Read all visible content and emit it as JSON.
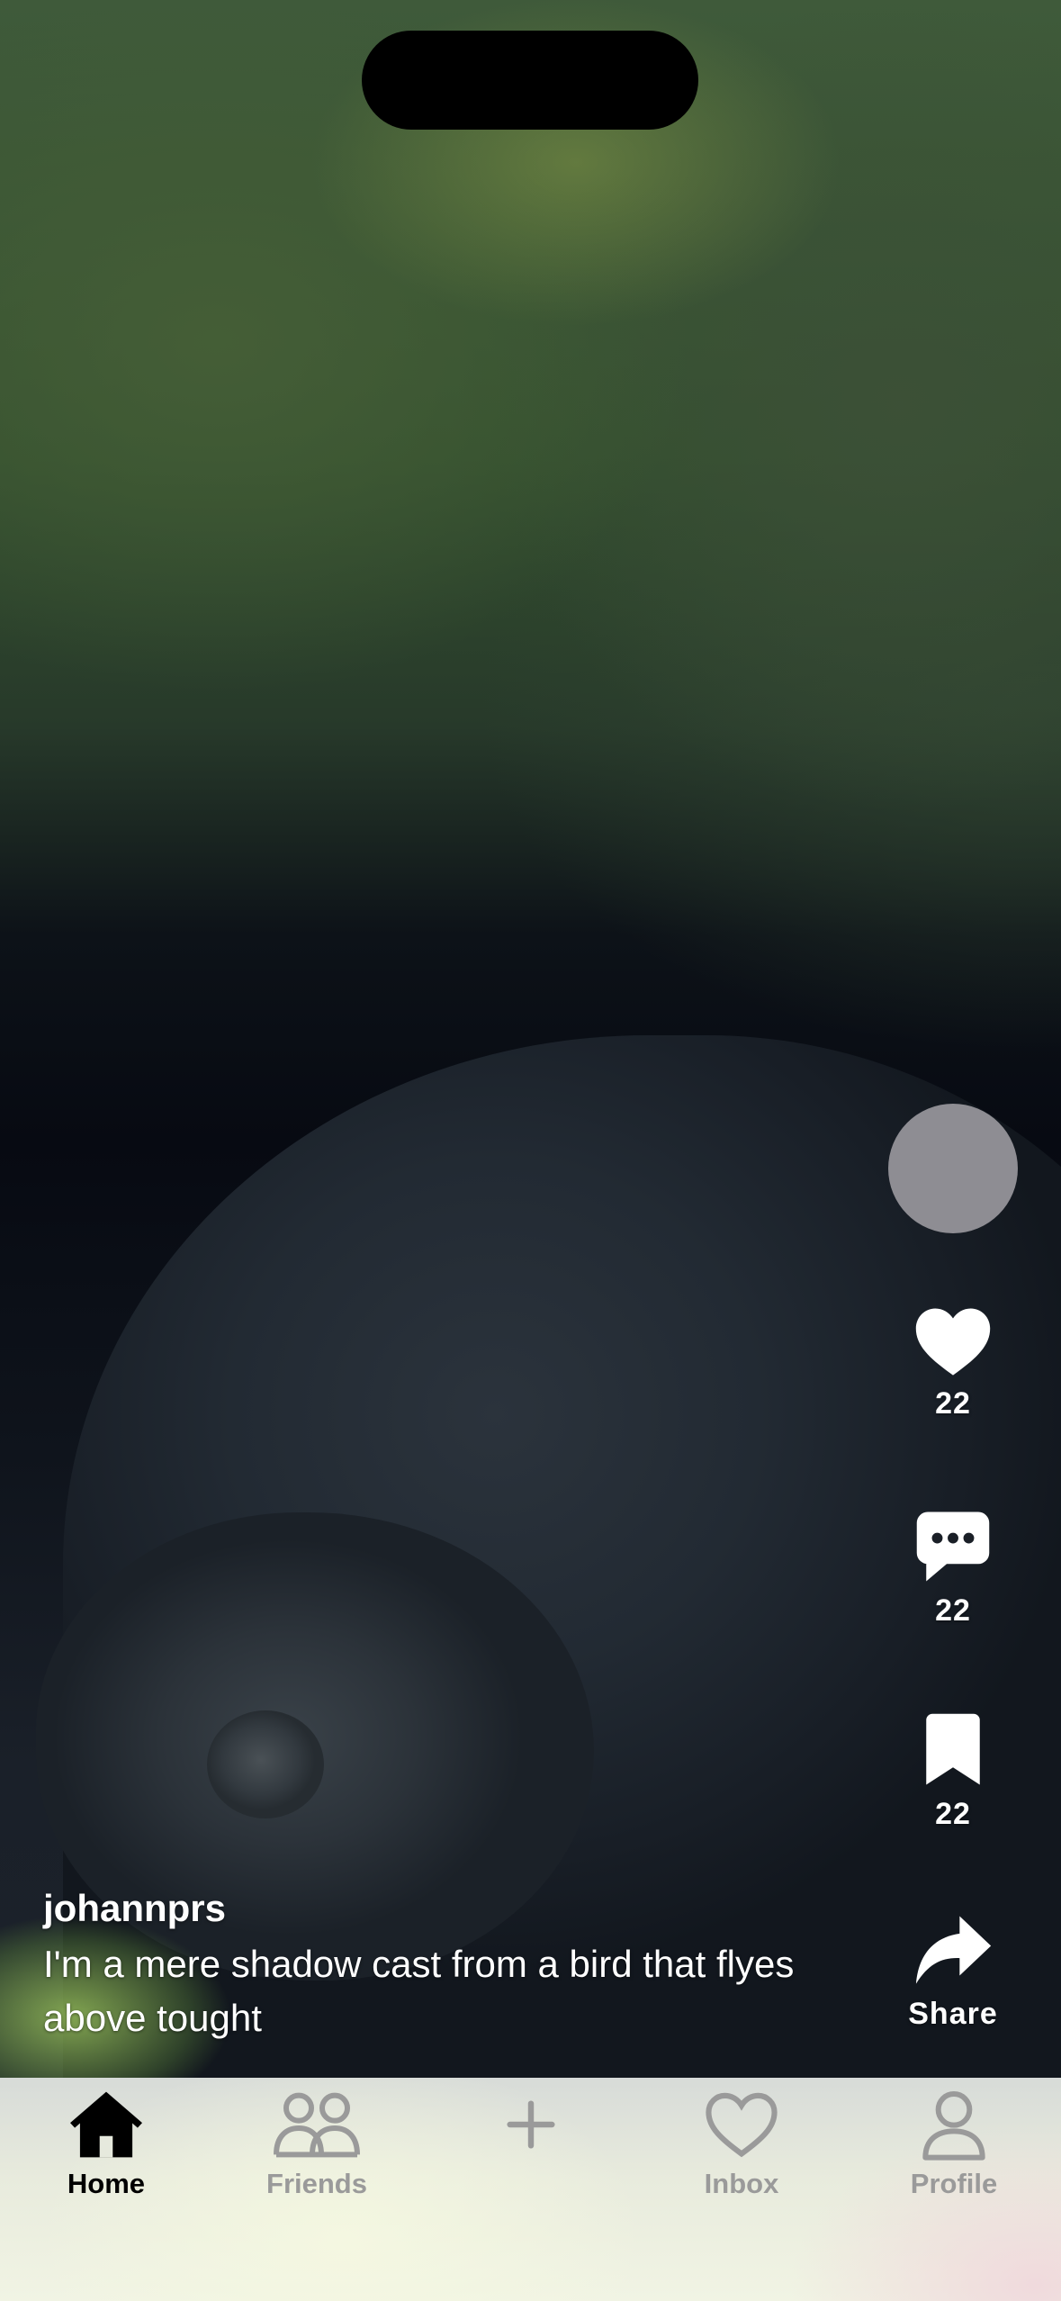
{
  "post": {
    "username": "johannprs",
    "caption": "I'm a mere shadow cast from a bird that flyes above tought"
  },
  "actions": {
    "likes": "22",
    "comments": "22",
    "saves": "22",
    "share_label": "Share"
  },
  "tabs": {
    "home": "Home",
    "friends": "Friends",
    "inbox": "Inbox",
    "profile": "Profile"
  },
  "icons": {
    "like": "heart-icon",
    "comment": "comment-icon",
    "save": "bookmark-icon",
    "share": "share-arrow-icon",
    "home": "home-icon",
    "friends": "friends-icon",
    "create": "plus-icon",
    "inbox": "heart-outline-icon",
    "profile": "person-icon"
  },
  "colors": {
    "active_tab": "#000000",
    "inactive_tab": "#9a9a9a",
    "avatar_placeholder": "#8e8d93",
    "overlay_text": "#ffffff"
  }
}
